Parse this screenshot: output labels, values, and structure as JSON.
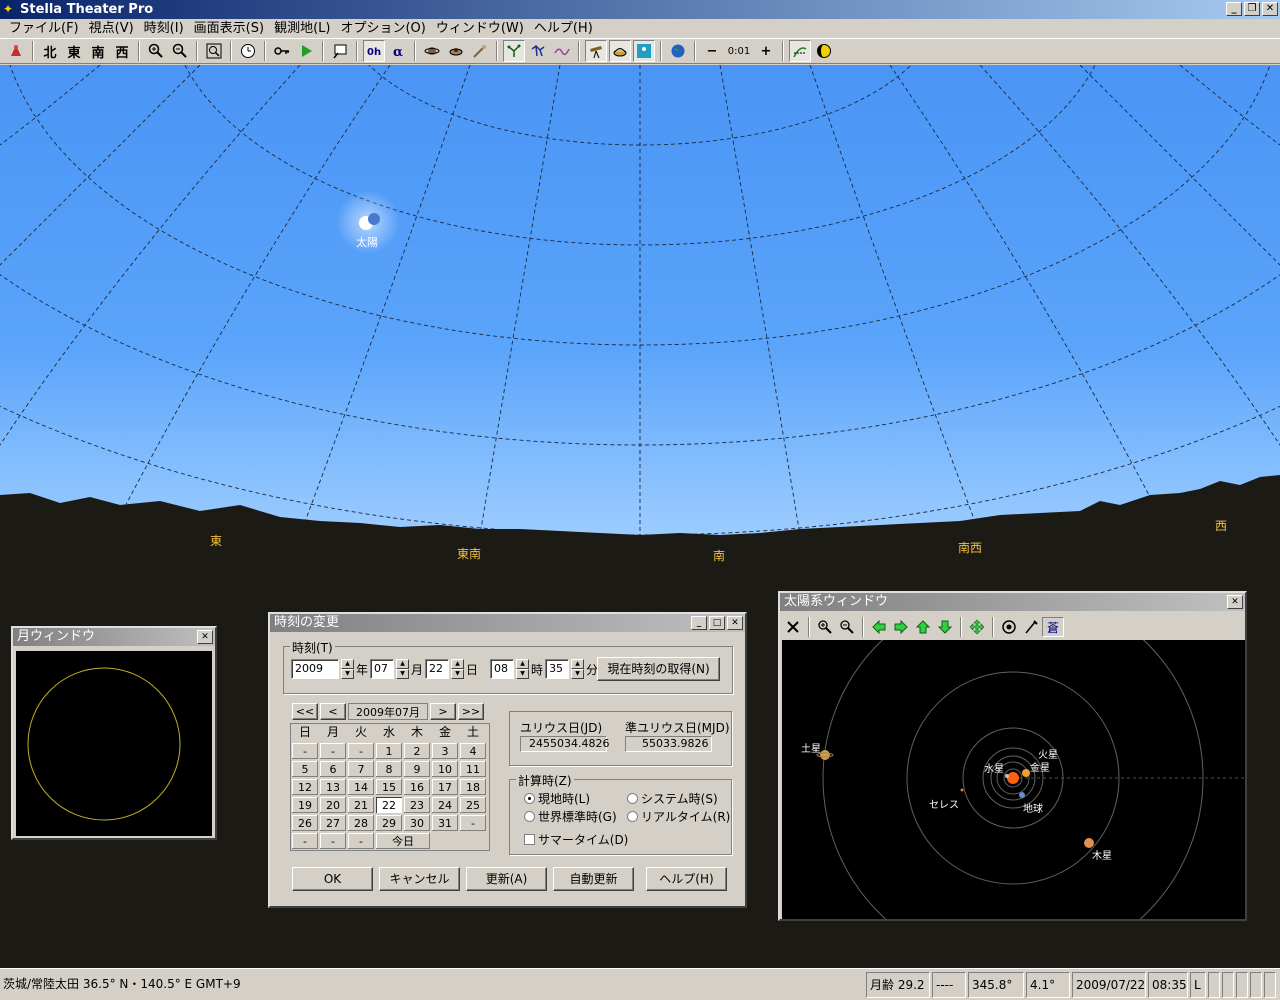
{
  "app": {
    "title": "Stella Theater Pro",
    "min": "_",
    "restore": "❐",
    "close": "✕"
  },
  "menu": [
    "ファイル(F)",
    "視点(V)",
    "時刻(I)",
    "画面表示(S)",
    "観測地(L)",
    "オプション(O)",
    "ウィンドウ(W)",
    "ヘルプ(H)"
  ],
  "toolbar": {
    "north": "北",
    "east": "東",
    "south": "南",
    "west": "西",
    "step": "0:01",
    "minus": "−",
    "plus": "+",
    "icons": [
      "observer-icon",
      "zoom-in-icon",
      "zoom-out-icon",
      "zoom-reset-icon",
      "clock-icon",
      "key-icon",
      "play-icon",
      "label-icon",
      "horizon-flag-icon",
      "alpha-icon",
      "planet-a-icon",
      "planet-b-icon",
      "comet-icon",
      "constellation-a-icon",
      "constellation-b-icon",
      "curve-icon",
      "telescope-icon",
      "satellite-icon",
      "sky-image-icon",
      "globe-icon",
      "grid-icon",
      "moon-phase-icon"
    ]
  },
  "sky": {
    "sun_label": "太陽",
    "directions": {
      "east": "東",
      "southeast": "東南",
      "south": "南",
      "southwest": "南西",
      "west": "西"
    },
    "colors": {
      "sky_top": "#4a95f5",
      "sky_horizon": "#8ec5ff",
      "ground": "#1c1a14",
      "direction_text": "#f0c040"
    }
  },
  "moon_window": {
    "title": "月ウィンドウ",
    "close": "✕"
  },
  "time_dialog": {
    "title": "時刻の変更",
    "group_time": "時刻(T)",
    "year": "2009",
    "year_unit": "年",
    "month": "07",
    "month_unit": "月",
    "day": "22",
    "day_unit": "日",
    "hour": "08",
    "hour_unit": "時",
    "minute": "35",
    "minute_unit": "分",
    "get_now": "現在時刻の取得(N)",
    "cal_prev_year": "<<",
    "cal_prev_month": "<",
    "cal_month": "2009年07月",
    "cal_next_month": ">",
    "cal_next_year": ">>",
    "weekdays": [
      "日",
      "月",
      "火",
      "水",
      "木",
      "金",
      "土"
    ],
    "days": [
      "-",
      "-",
      "-",
      "1",
      "2",
      "3",
      "4",
      "5",
      "6",
      "7",
      "8",
      "9",
      "10",
      "11",
      "12",
      "13",
      "14",
      "15",
      "16",
      "17",
      "18",
      "19",
      "20",
      "21",
      "22",
      "23",
      "24",
      "25",
      "26",
      "27",
      "28",
      "29",
      "30",
      "31",
      "-",
      "-",
      "-",
      "-",
      "-",
      "-"
    ],
    "today": "今日",
    "jd_label": "ユリウス日(JD)",
    "jd_value": "2455034.4826",
    "mjd_label": "準ユリウス日(MJD)",
    "mjd_value": "55033.9826",
    "group_calc": "計算時(Z)",
    "r_local": "現地時(L)",
    "r_system": "システム時(S)",
    "r_utc": "世界標準時(G)",
    "r_realtime": "リアルタイム(R)",
    "summer": "サマータイム(D)",
    "ok": "OK",
    "cancel": "キャンセル",
    "update": "更新(A)",
    "auto_update": "自動更新",
    "help": "ヘルプ(H)"
  },
  "solar_window": {
    "title": "太陽系ウィンドウ",
    "close": "✕",
    "labels": {
      "saturn": "土星",
      "mars": "火星",
      "mercury": "水星",
      "venus": "金星",
      "ceres": "セレス",
      "earth": "地球",
      "jupiter": "木星"
    },
    "icons": [
      "close-icon",
      "zoom-in-icon",
      "zoom-out-icon",
      "arrow-left-icon",
      "arrow-right-icon",
      "arrow-up-icon",
      "arrow-down-icon",
      "center-icon",
      "orbit-icon",
      "brush-icon",
      "label-icon"
    ]
  },
  "status": {
    "location": "茨城/常陸太田  36.5° N・140.5° E  GMT+9",
    "moon_age": "月齢 29.2",
    "s2": "----",
    "azimuth": "345.8°",
    "altitude": "4.1°",
    "date": "2009/07/22",
    "time": "08:35",
    "mode": "L"
  }
}
